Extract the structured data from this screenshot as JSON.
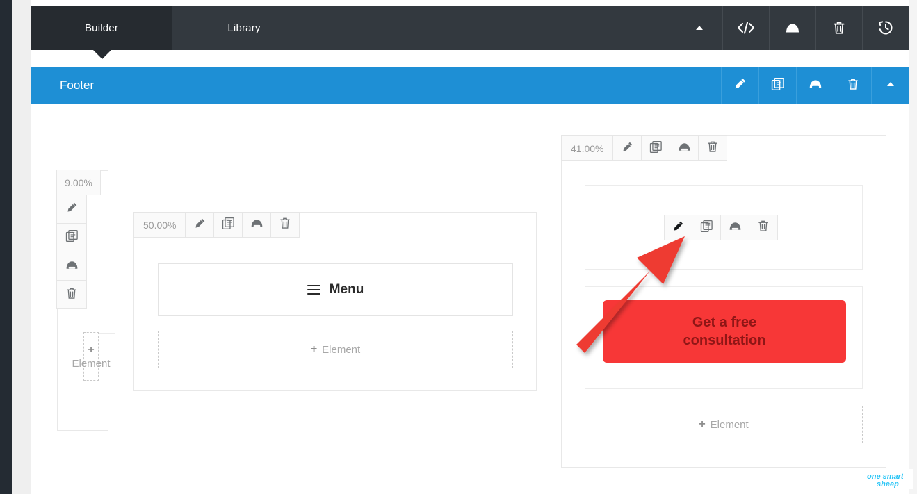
{
  "app": {
    "tabs": [
      {
        "label": "Builder",
        "active": true
      },
      {
        "label": "Library",
        "active": false
      }
    ],
    "toolbar": [
      {
        "name": "collapse-icon",
        "title": "Collapse"
      },
      {
        "name": "code-icon",
        "title": "Source code"
      },
      {
        "name": "save-icon",
        "title": "Save"
      },
      {
        "name": "trash-icon",
        "title": "Delete"
      },
      {
        "name": "history-icon",
        "title": "History"
      }
    ]
  },
  "section": {
    "title": "Footer",
    "color": "#1e8fd5",
    "tools": [
      {
        "name": "pencil-icon",
        "title": "Edit"
      },
      {
        "name": "duplicate-icon",
        "title": "Duplicate"
      },
      {
        "name": "save-icon",
        "title": "Save"
      },
      {
        "name": "trash-icon",
        "title": "Delete"
      },
      {
        "name": "collapse-icon",
        "title": "Collapse"
      }
    ]
  },
  "columns": [
    {
      "id": "left",
      "width_label": "9.00%",
      "tools": [
        {
          "name": "pencil-icon"
        },
        {
          "name": "duplicate-icon"
        },
        {
          "name": "save-icon"
        },
        {
          "name": "trash-icon"
        }
      ],
      "add_element_label": "Element",
      "add_element_plus": "+"
    },
    {
      "id": "middle",
      "width_label": "50.00%",
      "tools": [
        {
          "name": "pencil-icon"
        },
        {
          "name": "duplicate-icon"
        },
        {
          "name": "save-icon"
        },
        {
          "name": "trash-icon"
        }
      ],
      "menu_label": "Menu",
      "add_element_label": "Element",
      "add_element_plus": "+"
    },
    {
      "id": "right",
      "width_label": "41.00%",
      "tools": [
        {
          "name": "pencil-icon"
        },
        {
          "name": "duplicate-icon"
        },
        {
          "name": "save-icon"
        },
        {
          "name": "trash-icon"
        }
      ],
      "element_tools": [
        {
          "name": "pencil-icon",
          "state": "hover"
        },
        {
          "name": "duplicate-icon"
        },
        {
          "name": "save-icon"
        },
        {
          "name": "trash-icon"
        }
      ],
      "cta": {
        "line1": "Get a free",
        "line2": "consultation",
        "background": "#f73737",
        "text_color": "#8f1616"
      },
      "add_element_label": "Element",
      "add_element_plus": "+"
    }
  ],
  "annotation": {
    "type": "arrow",
    "color": "#ee3b32",
    "points_to": "element-pencil-icon"
  },
  "watermark": {
    "line1": "one smart",
    "line2": "sheep",
    "color": "#29c5f6"
  }
}
